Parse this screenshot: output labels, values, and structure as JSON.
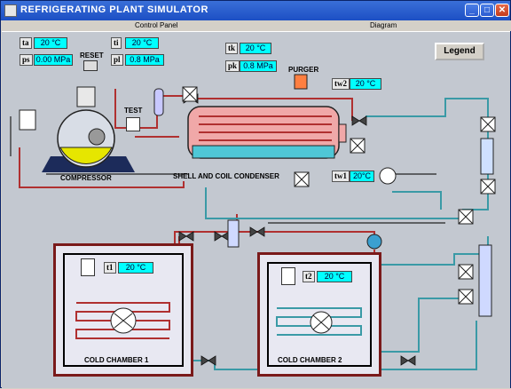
{
  "window": {
    "title": "REFRIGERATING PLANT SIMULATOR"
  },
  "menu": {
    "control_panel": "Control Panel",
    "diagram": "Diagram"
  },
  "legend_button": "Legend",
  "compressor": {
    "ta_label": "ta",
    "ta_value": "20 °C",
    "ps_label": "ps",
    "ps_value": "0.00 MPa",
    "reset_label": "RESET",
    "ti_label": "ti",
    "ti_value": "20 °C",
    "pi_label": "pl",
    "pi_value": "0.8 MPa",
    "test_label": "TEST",
    "name": "COMPRESSOR"
  },
  "condenser": {
    "tk_label": "tk",
    "tk_value": "20 °C",
    "pk_label": "pk",
    "pk_value": "0.8 MPa",
    "purger_label": "PURGER",
    "tw2_label": "tw2",
    "tw2_value": "20 °C",
    "tw1_label": "tw1",
    "tw1_value": "20°C",
    "name": "SHELL AND COIL CONDENSER"
  },
  "chamber1": {
    "t_label": "t1",
    "t_value": "20 °C",
    "name": "COLD CHAMBER 1"
  },
  "chamber2": {
    "t_label": "t2",
    "t_value": "20 °C",
    "name": "COLD CHAMBER 2"
  },
  "colors": {
    "cyan": "#00ffff",
    "pipe_red": "#b03030",
    "pipe_teal": "#3a9aa6",
    "chamber_border": "#7a1a1a"
  }
}
